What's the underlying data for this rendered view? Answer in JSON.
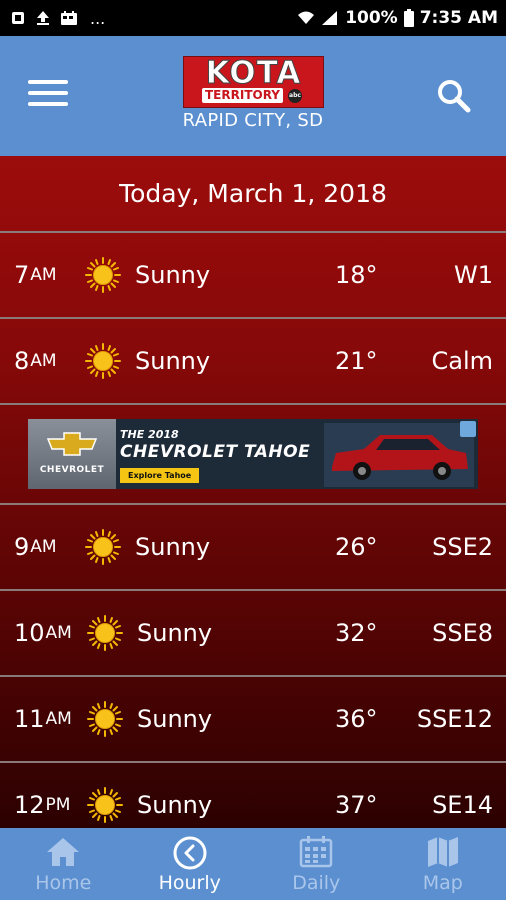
{
  "status_bar": {
    "battery": "100%",
    "time": "7:35 AM",
    "more": "..."
  },
  "header": {
    "logo_main": "KOTA",
    "logo_sub": "TERRITORY",
    "logo_network": "abc",
    "location": "RAPID CITY, SD"
  },
  "date": "Today, March 1, 2018",
  "hours": [
    {
      "hour": "7",
      "ampm": "AM",
      "condition": "Sunny",
      "temp": "18°",
      "wind": "W1"
    },
    {
      "hour": "8",
      "ampm": "AM",
      "condition": "Sunny",
      "temp": "21°",
      "wind": "Calm"
    },
    {
      "hour": "9",
      "ampm": "AM",
      "condition": "Sunny",
      "temp": "26°",
      "wind": "SSE2"
    },
    {
      "hour": "10",
      "ampm": "AM",
      "condition": "Sunny",
      "temp": "32°",
      "wind": "SSE8"
    },
    {
      "hour": "11",
      "ampm": "AM",
      "condition": "Sunny",
      "temp": "36°",
      "wind": "SSE12"
    },
    {
      "hour": "12",
      "ampm": "PM",
      "condition": "Sunny",
      "temp": "37°",
      "wind": "SE14"
    }
  ],
  "ad": {
    "brand": "CHEVROLET",
    "line1": "THE 2018",
    "line2": "CHEVROLET TAHOE",
    "cta": "Explore Tahoe"
  },
  "nav": {
    "home": "Home",
    "hourly": "Hourly",
    "daily": "Daily",
    "map": "Map",
    "active": "hourly"
  },
  "colors": {
    "header_blue": "#5b8fd0",
    "content_red": "#9c0c0c",
    "sun_yellow": "#f5b800"
  }
}
